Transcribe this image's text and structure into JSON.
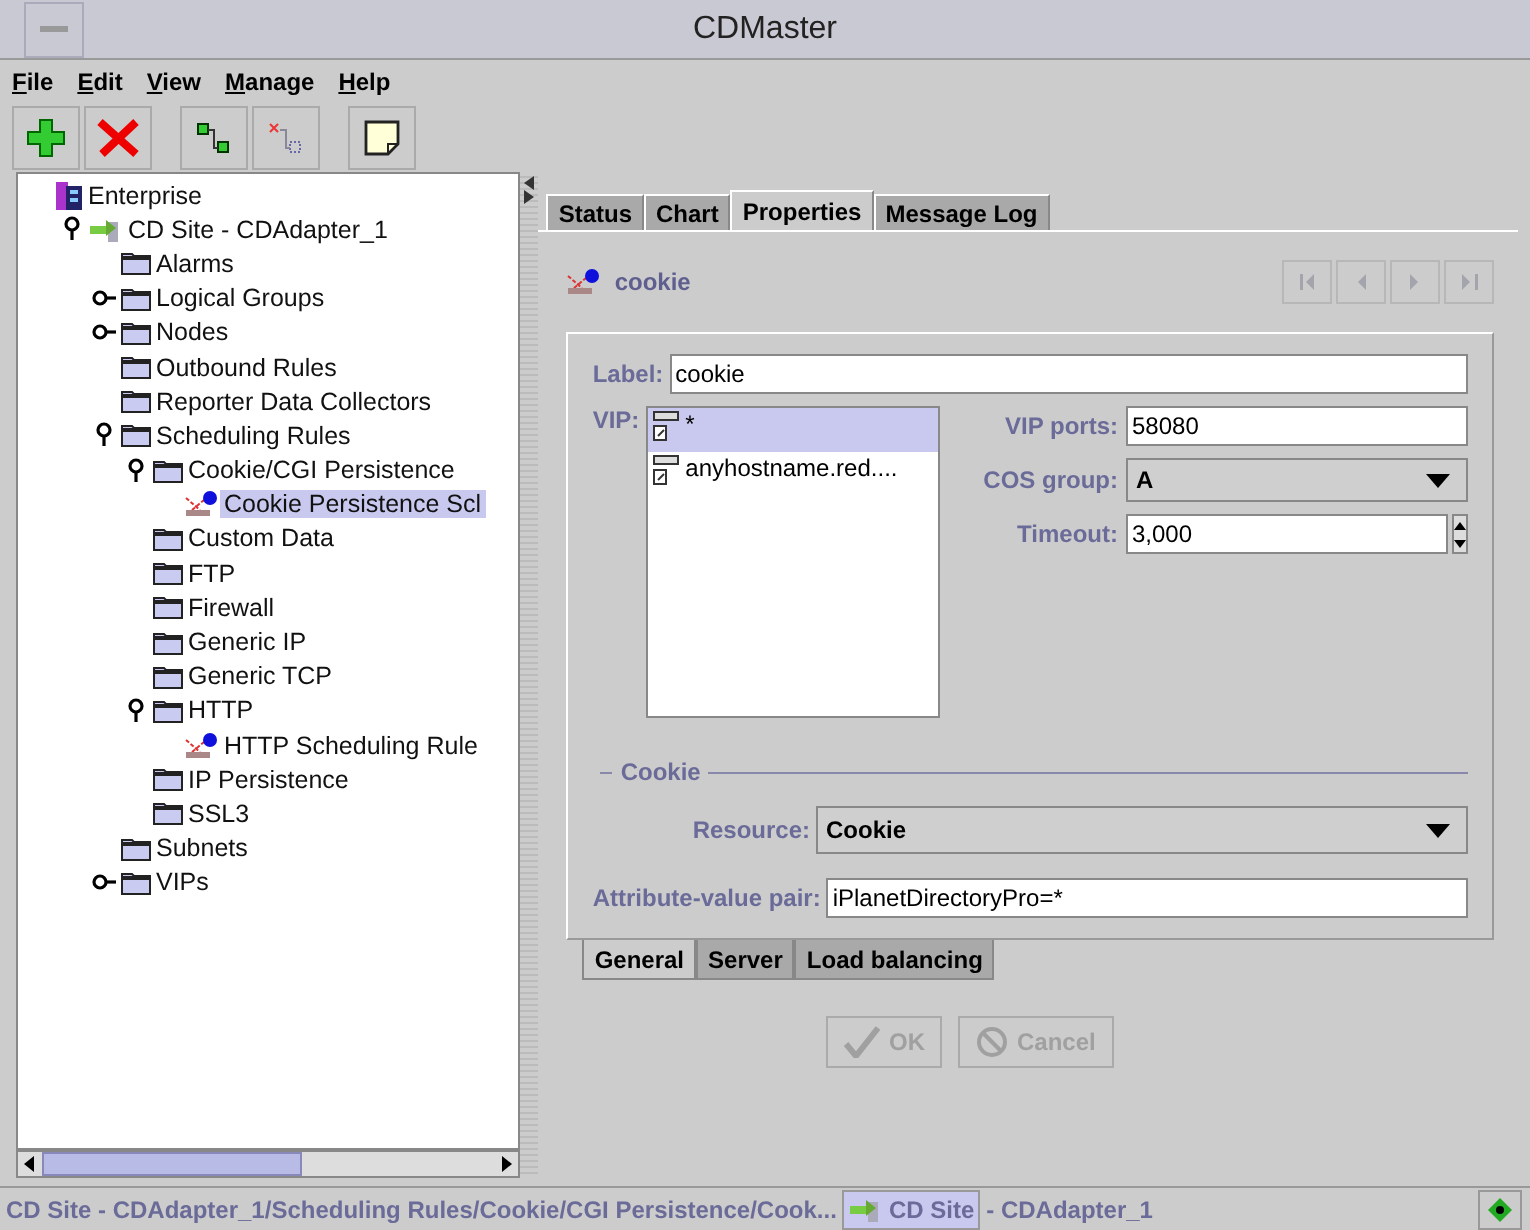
{
  "window": {
    "title": "CDMaster"
  },
  "menu": [
    {
      "label": "File"
    },
    {
      "label": "Edit"
    },
    {
      "label": "View"
    },
    {
      "label": "Manage"
    },
    {
      "label": "Help"
    }
  ],
  "toolbar": [
    {
      "kind": "add"
    },
    {
      "kind": "delete"
    },
    {
      "kind": "connect"
    },
    {
      "kind": "disconnect"
    },
    {
      "kind": "note"
    }
  ],
  "tree": [
    {
      "label": "Enterprise",
      "kind": "enterprise",
      "selected": false,
      "children": [
        {
          "label": "CD Site - CDAdapter_1",
          "kind": "site",
          "expanded": true,
          "selected": false,
          "children": [
            {
              "label": "Alarms",
              "kind": "folder",
              "selected": false
            },
            {
              "label": "Logical Groups",
              "kind": "folder",
              "expanded": false,
              "selected": false
            },
            {
              "label": "Nodes",
              "kind": "folder",
              "expanded": false,
              "selected": false
            },
            {
              "label": "Outbound Rules",
              "kind": "folder",
              "selected": false
            },
            {
              "label": "Reporter Data Collectors",
              "kind": "folder",
              "selected": false
            },
            {
              "label": "Scheduling Rules",
              "kind": "folder",
              "expanded": true,
              "selected": false,
              "children": [
                {
                  "label": "Cookie/CGI Persistence",
                  "kind": "folder",
                  "expanded": true,
                  "selected": false,
                  "children": [
                    {
                      "label": "Cookie Persistence Scl",
                      "kind": "rule",
                      "selected": true
                    }
                  ]
                },
                {
                  "label": "Custom Data",
                  "kind": "folder",
                  "selected": false
                },
                {
                  "label": "FTP",
                  "kind": "folder",
                  "selected": false
                },
                {
                  "label": "Firewall",
                  "kind": "folder",
                  "selected": false
                },
                {
                  "label": "Generic IP",
                  "kind": "folder",
                  "selected": false
                },
                {
                  "label": "Generic TCP",
                  "kind": "folder",
                  "selected": false
                },
                {
                  "label": "HTTP",
                  "kind": "folder",
                  "expanded": true,
                  "selected": false,
                  "children": [
                    {
                      "label": "HTTP Scheduling Rule",
                      "kind": "rule",
                      "selected": false
                    }
                  ]
                },
                {
                  "label": "IP Persistence",
                  "kind": "folder",
                  "selected": false
                },
                {
                  "label": "SSL3",
                  "kind": "folder",
                  "selected": false
                }
              ]
            },
            {
              "label": "Subnets",
              "kind": "folder",
              "selected": false
            },
            {
              "label": "VIPs",
              "kind": "folder",
              "expanded": false,
              "selected": false
            }
          ]
        }
      ]
    }
  ],
  "tabs": [
    {
      "label": "Status",
      "selected": false
    },
    {
      "label": "Chart",
      "selected": false
    },
    {
      "label": "Properties",
      "selected": true
    },
    {
      "label": "Message Log",
      "selected": false
    }
  ],
  "object_title": "cookie",
  "nav_buttons": [
    {
      "kind": "first",
      "disabled": true
    },
    {
      "kind": "prev",
      "disabled": true
    },
    {
      "kind": "next",
      "disabled": true
    },
    {
      "kind": "last",
      "disabled": true
    }
  ],
  "form": {
    "label_field": {
      "label": "Label:",
      "value": "cookie"
    },
    "vip": {
      "label": "VIP:",
      "items": [
        {
          "label": "*",
          "selected": true
        },
        {
          "label": "anyhostname.red....",
          "selected": false
        }
      ]
    },
    "vip_ports": {
      "label": "VIP ports:",
      "value": "58080"
    },
    "cos_group": {
      "label": "COS group:",
      "value": "A"
    },
    "timeout": {
      "label": "Timeout:",
      "value": "3,000"
    },
    "section": "Cookie",
    "resource": {
      "label": "Resource:",
      "value": "Cookie"
    },
    "attribute": {
      "label": "Attribute-value pair:",
      "value": "iPlanetDirectoryPro=*"
    }
  },
  "sub_tabs": [
    {
      "label": "General",
      "selected": true
    },
    {
      "label": "Server",
      "selected": false
    },
    {
      "label": "Load balancing",
      "selected": false
    }
  ],
  "buttons": [
    {
      "label": "OK",
      "kind": "ok",
      "disabled": true
    },
    {
      "label": "Cancel",
      "kind": "cancel",
      "disabled": true
    }
  ],
  "status_bar": {
    "path": "CD Site - CDAdapter_1/Scheduling Rules/Cookie/CGI Persistence/Cook...",
    "site": "CD Site",
    "adapter": "- CDAdapter_1"
  }
}
